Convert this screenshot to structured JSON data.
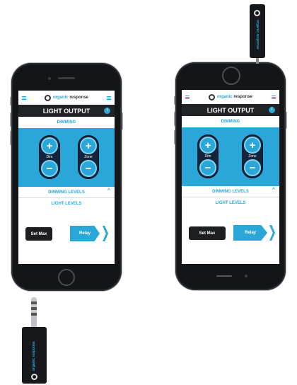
{
  "brand": {
    "name_part1": "organic",
    "name_part2": "response"
  },
  "screen": {
    "title": "LIGHT OUTPUT",
    "info_badge": "i",
    "section_dimming": "DIMMING",
    "controls": [
      {
        "label": "Dim",
        "plus": "+",
        "minus": "−"
      },
      {
        "label": "Zone",
        "plus": "+",
        "minus": "−"
      }
    ],
    "dimming_levels": "DIMMING LEVELS",
    "dimming_levels_chevron": "^",
    "light_levels": "LIGHT LEVELS",
    "set_max_label": "Set Max",
    "relay_label": "Relay"
  },
  "dongle_text": "organic response",
  "colors": {
    "accent": "#2aa6d8",
    "dark": "#222326",
    "phone": "#141518"
  }
}
